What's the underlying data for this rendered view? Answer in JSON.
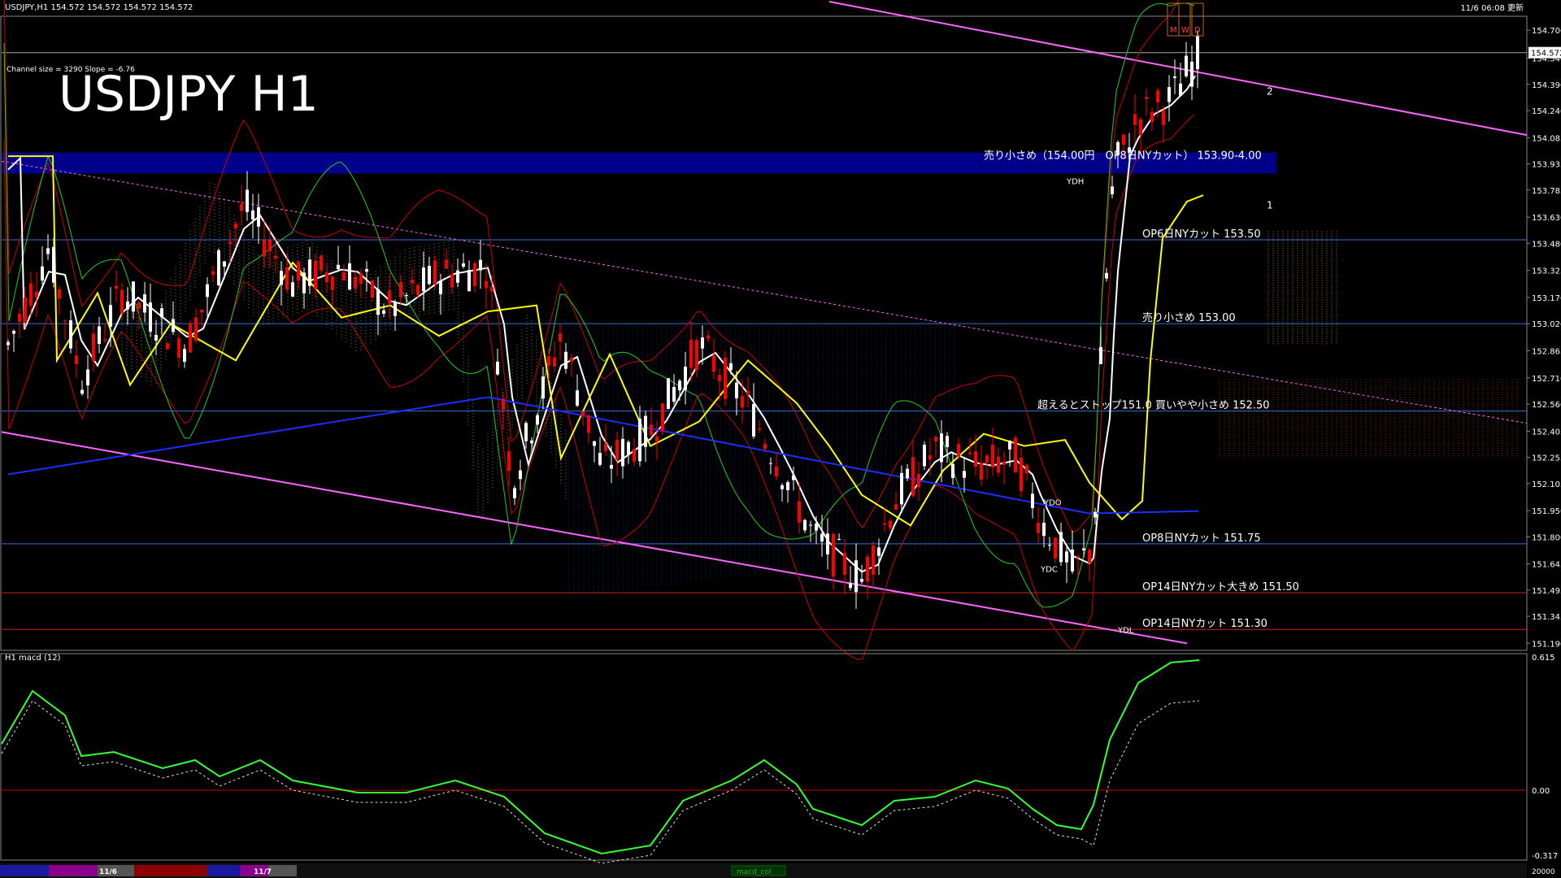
{
  "window": {
    "symbol_header": "USDJPY,H1  154.572 154.572 154.572 154.572",
    "datetime": "11/6 06:08 更新",
    "channel_info": "Channel size = 3290 Slope = -6.76",
    "big_title": "USDJPY H1"
  },
  "price_axis": {
    "current_price": "154.572",
    "ticks": [
      "154.700",
      "154.540",
      "154.390",
      "154.240",
      "154.085",
      "153.935",
      "153.785",
      "153.630",
      "153.480",
      "153.325",
      "153.170",
      "153.020",
      "152.865",
      "152.710",
      "152.560",
      "152.405",
      "152.255",
      "152.105",
      "151.950",
      "151.800",
      "151.645",
      "151.495",
      "151.345",
      "151.190"
    ]
  },
  "annotations": [
    {
      "text": "売り小さめ（154.00円　OP8日NYカット） 153.90-4.00",
      "price": 153.95
    },
    {
      "text": "OP6日NYカット 153.50",
      "price": 153.5
    },
    {
      "text": "売り小さめ 153.00",
      "price": 153.02
    },
    {
      "text": "超えるとストップ151.0 買いやや小さめ 152.50",
      "price": 152.52
    },
    {
      "text": "OP8日NYカット 151.75",
      "price": 151.76
    },
    {
      "text": "OP14日NYカット大きめ 151.50",
      "price": 151.48
    },
    {
      "text": "OP14日NYカット 151.30",
      "price": 151.27
    }
  ],
  "labels": {
    "ydo": "YDO",
    "ydc": "YDC",
    "ydl": "YDL",
    "ydh": "YDH",
    "m": "M",
    "w": "W",
    "d": "D",
    "line1": "1",
    "line2": "2"
  },
  "macd": {
    "label": "H1  macd (12)",
    "axis_top": "0.615",
    "axis_zero": "0.00",
    "axis_bottom": "-0.317"
  },
  "bottom_bar": {
    "date1": "11/6",
    "date2": "11/7",
    "right_value": "20000",
    "tab_label": "macd_col"
  },
  "colors": {
    "bull": "#ffffff",
    "bear": "#ff0000",
    "sma_white": "#ffffff",
    "sma_yellow": "#ffff00",
    "sma_blue": "#1a2fff",
    "channel": "#ff66ff",
    "band": "#00008b",
    "macd_green": "#33ff33",
    "macd_pink": "#ff6699"
  }
}
